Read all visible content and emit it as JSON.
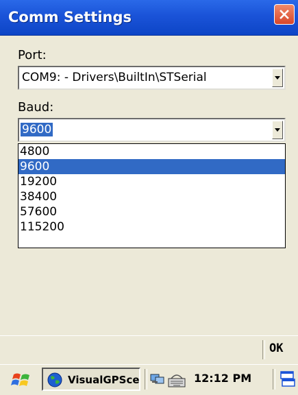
{
  "window": {
    "title": "Comm Settings"
  },
  "port": {
    "label": "Port:",
    "value": "COM9: - Drivers\\BuiltIn\\STSerial"
  },
  "baud": {
    "label": "Baud:",
    "value": "9600",
    "options": [
      "4800",
      "9600",
      "19200",
      "38400",
      "57600",
      "115200"
    ],
    "selected": "9600"
  },
  "command_bar": {
    "ok_label": "OK"
  },
  "taskbar": {
    "task_label": "VisualGPSce",
    "clock": "12:12 PM"
  },
  "colors": {
    "titlebar": "#1a53d8",
    "selection": "#316ac5",
    "background": "#ece9d8",
    "close_button": "#d8462a"
  },
  "icons": {
    "close": "close-icon",
    "dropdown": "chevron-down-icon",
    "start": "windows-flag-icon",
    "task": "globe-icon",
    "network": "network-icon",
    "keyboard": "keyboard-icon",
    "desktop": "desktop-icon"
  }
}
